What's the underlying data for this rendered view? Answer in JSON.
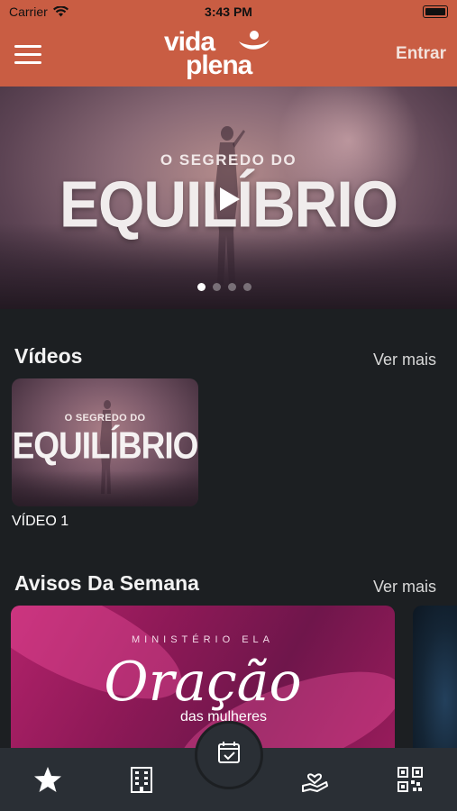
{
  "status_bar": {
    "carrier": "Carrier",
    "time": "3:43 PM"
  },
  "header": {
    "logo_line1": "vida",
    "logo_line2": "plena",
    "login_label": "Entrar",
    "background_color": "#c95d43"
  },
  "hero": {
    "kicker": "O SEGREDO DO",
    "headline": "EQUILÍBRIO",
    "slide_count": 4,
    "active_slide": 1
  },
  "videos": {
    "title": "Vídeos",
    "see_more": "Ver mais",
    "items": [
      {
        "kicker": "O SEGREDO DO",
        "headline": "EQUILÍBRIO",
        "caption": "VÍDEO 1"
      }
    ]
  },
  "notices": {
    "title": "Avisos Da Semana",
    "see_more": "Ver mais",
    "items": [
      {
        "kicker": "MINISTÉRIO ELA",
        "headline": "Oração",
        "subtitle": "das mulheres"
      }
    ]
  },
  "tab_bar": {
    "icons": [
      "star-icon",
      "building-icon",
      "calendar-check-icon",
      "hand-heart-icon",
      "qr-code-icon"
    ],
    "active": "calendar-check-icon"
  }
}
